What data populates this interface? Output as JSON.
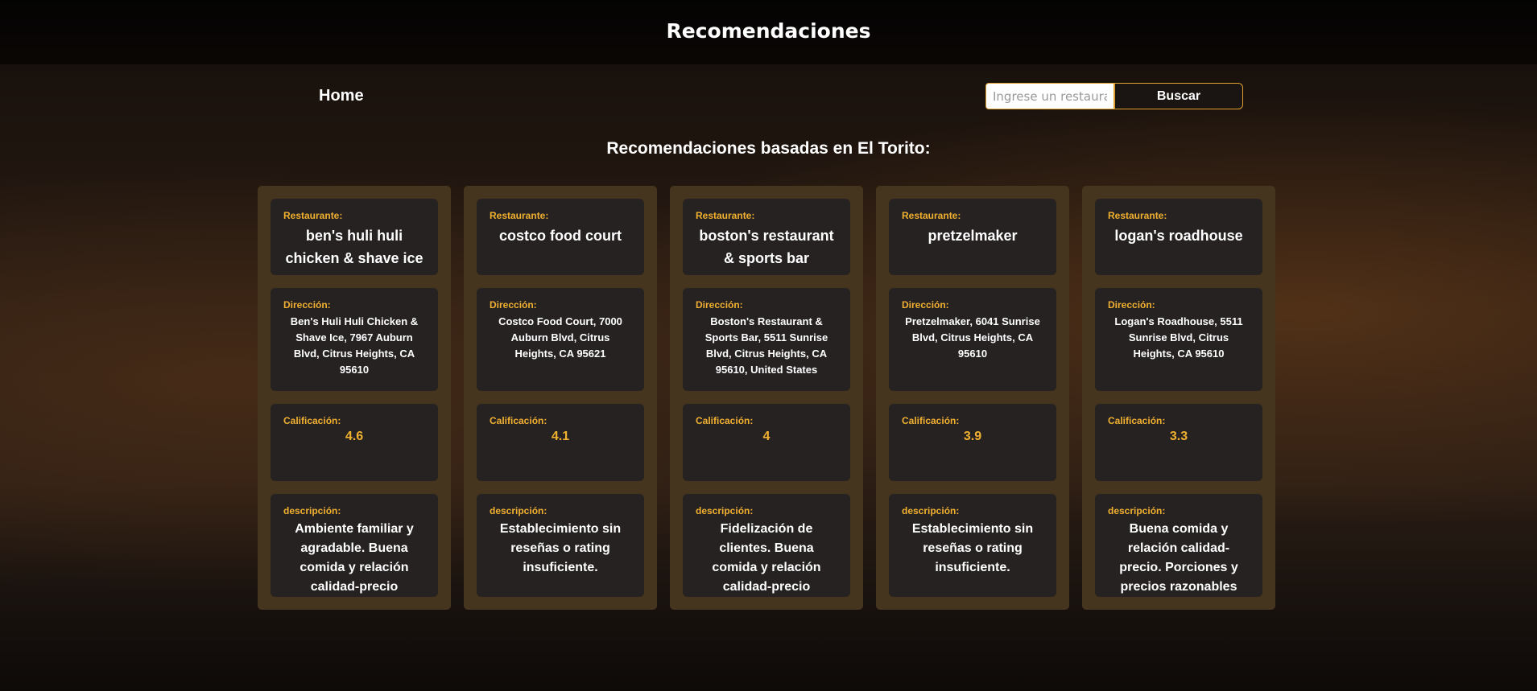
{
  "header": {
    "title": "Recomendaciones",
    "home": "Home",
    "search_placeholder": "Ingrese un restaurante",
    "search_button": "Buscar"
  },
  "subtitle": "Recomendaciones basadas en El Torito:",
  "labels": {
    "restaurant": "Restaurante:",
    "address": "Dirección:",
    "rating": "Calificación:",
    "description": "descripción:"
  },
  "cards": [
    {
      "name": "ben's huli huli chicken & shave ice",
      "address": "Ben's Huli Huli Chicken & Shave Ice, 7967 Auburn Blvd, Citrus Heights, CA 95610",
      "rating": "4.6",
      "description": "Ambiente familiar y agradable. Buena comida y relación calidad-precio"
    },
    {
      "name": "costco food court",
      "address": "Costco Food Court, 7000 Auburn Blvd, Citrus Heights, CA 95621",
      "rating": "4.1",
      "description": "Establecimiento sin reseñas o rating insuficiente."
    },
    {
      "name": "boston's restaurant & sports bar",
      "address": "Boston's Restaurant & Sports Bar, 5511 Sunrise Blvd, Citrus Heights, CA 95610, United States",
      "rating": "4",
      "description": "Fidelización de clientes. Buena comida y relación calidad-precio"
    },
    {
      "name": "pretzelmaker",
      "address": "Pretzelmaker, 6041 Sunrise Blvd, Citrus Heights, CA 95610",
      "rating": "3.9",
      "description": "Establecimiento sin reseñas o rating insuficiente."
    },
    {
      "name": "logan's roadhouse",
      "address": "Logan's Roadhouse, 5511 Sunrise Blvd, Citrus Heights, CA 95610",
      "rating": "3.3",
      "description": "Buena comida y relación calidad-precio. Porciones y precios razonables"
    }
  ]
}
